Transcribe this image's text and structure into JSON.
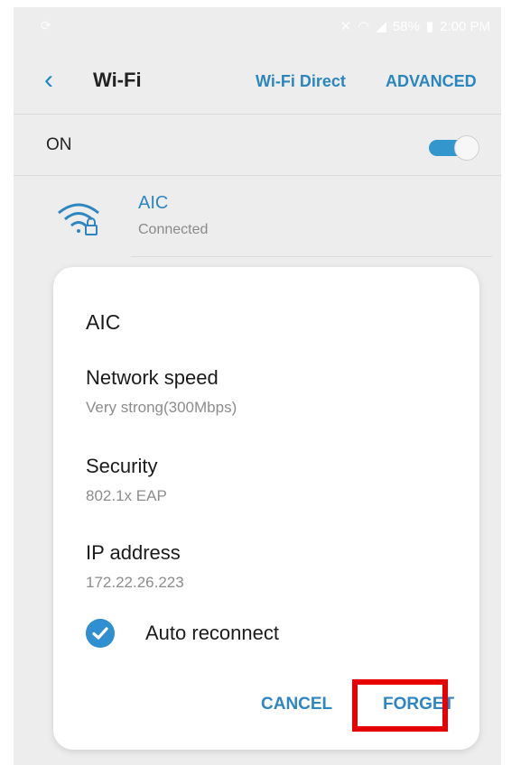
{
  "status_bar": {
    "left_icon": "sync-icon",
    "battery": "58%",
    "time": "2:00 PM"
  },
  "header": {
    "title": "Wi-Fi",
    "wifi_direct": "Wi-Fi Direct",
    "advanced": "ADVANCED"
  },
  "wifi_toggle": {
    "label": "ON",
    "state": "on"
  },
  "network": {
    "name": "AIC",
    "status": "Connected",
    "icon": "wifi-lock-icon"
  },
  "dialog": {
    "title": "AIC",
    "network_speed_label": "Network speed",
    "network_speed_value": "Very strong(300Mbps)",
    "security_label": "Security",
    "security_value": "802.1x EAP",
    "ip_label": "IP address",
    "ip_value": "172.22.26.223",
    "auto_reconnect_label": "Auto reconnect",
    "auto_reconnect_checked": true,
    "cancel": "CANCEL",
    "forget": "FORGET"
  },
  "colors": {
    "accent": "#2f86c3",
    "highlight": "#e60000",
    "background": "#ededed"
  }
}
